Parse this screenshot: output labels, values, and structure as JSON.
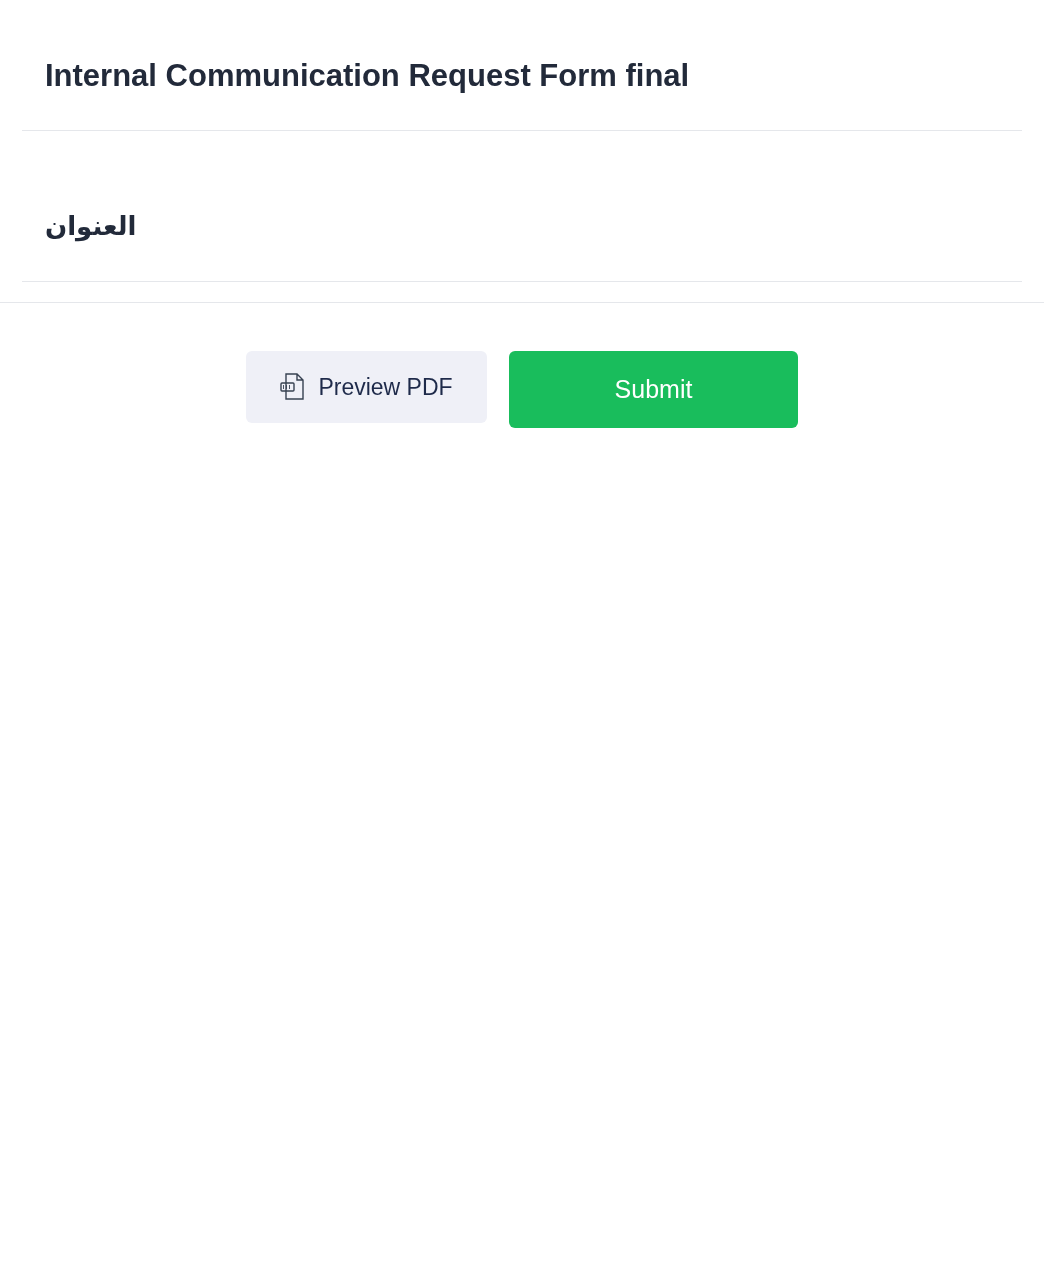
{
  "form": {
    "title": "Internal Communication Request Form final"
  },
  "fields": [
    {
      "label": "العنوان"
    }
  ],
  "buttons": [
    {
      "kind": "secondary",
      "label": "Preview PDF"
    },
    {
      "kind": "primary",
      "label": "Submit"
    }
  ]
}
